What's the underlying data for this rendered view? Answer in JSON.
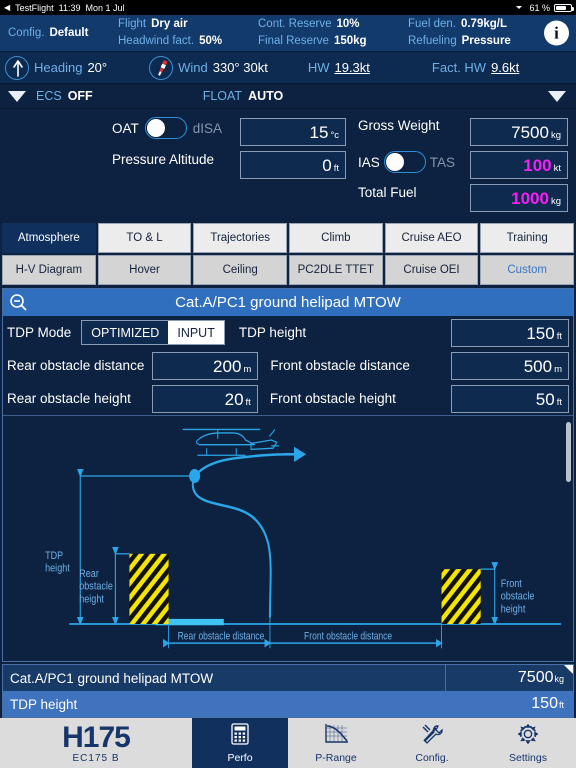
{
  "statusbar": {
    "back_label": "TestFlight",
    "time": "11:39",
    "date": "Mon 1 Jul",
    "battery_percent": "61 %"
  },
  "config_header": {
    "config_label": "Config.",
    "config_value": "Default",
    "flight_label": "Flight",
    "flight_value": "Dry air",
    "headwind_label": "Headwind fact.",
    "headwind_value": "50%",
    "cont_reserve_label": "Cont. Reserve",
    "cont_reserve_value": "10%",
    "final_reserve_label": "Final Reserve",
    "final_reserve_value": "150kg",
    "fuel_den_label": "Fuel den.",
    "fuel_den_value": "0.79kg/L",
    "refueling_label": "Refueling",
    "refueling_value": "Pressure",
    "info_label": "i"
  },
  "windbar": {
    "heading_label": "Heading",
    "heading_value": "20°",
    "wind_label": "Wind",
    "wind_value": "330° 30kt",
    "hw_label": "HW",
    "hw_value": "19.3kt",
    "fact_hw_label": "Fact. HW",
    "fact_hw_value": "9.6kt"
  },
  "ecsbar": {
    "ecs_label": "ECS",
    "ecs_value": "OFF",
    "float_label": "FLOAT",
    "float_value": "AUTO"
  },
  "inputs": {
    "oat_label": "OAT",
    "disa_label": "dISA",
    "oat_value": "15",
    "oat_unit": "°c",
    "pressure_alt_label": "Pressure Altitude",
    "pressure_alt_value": "0",
    "pressure_alt_unit": "ft",
    "gross_weight_label": "Gross Weight",
    "gross_weight_value": "7500",
    "gross_weight_unit": "kg",
    "ias_label": "IAS",
    "tas_label": "TAS",
    "ias_value": "100",
    "ias_unit": "kt",
    "total_fuel_label": "Total Fuel",
    "total_fuel_value": "1000",
    "total_fuel_unit": "kg"
  },
  "tabs": {
    "row1": [
      {
        "label": "Atmosphere",
        "state": "normal"
      },
      {
        "label": "TO & L",
        "state": "selected"
      },
      {
        "label": "Trajectories",
        "state": "normal"
      },
      {
        "label": "Climb",
        "state": "normal"
      },
      {
        "label": "Cruise AEO",
        "state": "normal"
      },
      {
        "label": "Training",
        "state": "normal"
      }
    ],
    "row2": [
      {
        "label": "H-V Diagram",
        "state": "alt"
      },
      {
        "label": "Hover",
        "state": "alt"
      },
      {
        "label": "Ceiling",
        "state": "alt"
      },
      {
        "label": "PC2DLE TTET",
        "state": "alt"
      },
      {
        "label": "Cruise OEI",
        "state": "alt"
      },
      {
        "label": "Custom",
        "state": "link"
      }
    ]
  },
  "panel": {
    "title": "Cat.A/PC1 ground helipad MTOW",
    "tdp_mode_label": "TDP Mode",
    "tdp_mode_optimized": "OPTIMIZED",
    "tdp_mode_input": "INPUT",
    "tdp_height_label": "TDP height",
    "tdp_height_value": "150",
    "tdp_height_unit": "ft",
    "rear_obstacle_distance_label": "Rear obstacle distance",
    "rear_obstacle_distance_value": "200",
    "rear_obstacle_distance_unit": "m",
    "front_obstacle_distance_label": "Front obstacle distance",
    "front_obstacle_distance_value": "500",
    "front_obstacle_distance_unit": "m",
    "rear_obstacle_height_label": "Rear obstacle height",
    "rear_obstacle_height_value": "20",
    "rear_obstacle_height_unit": "ft",
    "front_obstacle_height_label": "Front obstacle height",
    "front_obstacle_height_value": "50",
    "front_obstacle_height_unit": "ft"
  },
  "diagram": {
    "tdp_height_caption": "TDP\nheight",
    "tdp_height_line1": "TDP",
    "tdp_height_line2": "height",
    "rear_obstacle_height_line1": "Rear",
    "rear_obstacle_height_line2": "obstacle",
    "rear_obstacle_height_line3": "height",
    "front_obstacle_height_line1": "Front",
    "front_obstacle_height_line2": "obstacle",
    "front_obstacle_height_line3": "height",
    "rear_obstacle_distance_caption": "Rear obstacle distance",
    "front_obstacle_distance_caption": "Front obstacle distance"
  },
  "results": [
    {
      "label": "Cat.A/PC1 ground helipad MTOW",
      "value": "7500",
      "unit": "kg",
      "style": "dark"
    },
    {
      "label": "TDP height",
      "value": "150",
      "unit": "ft",
      "style": "light"
    }
  ],
  "bottombar": {
    "model": "H175",
    "model_sub": "EC175 B",
    "items": [
      {
        "label": "Perfo",
        "icon": "calculator-icon",
        "active": true
      },
      {
        "label": "P-Range",
        "icon": "chart-icon",
        "active": false
      },
      {
        "label": "Config.",
        "icon": "tools-icon",
        "active": false
      },
      {
        "label": "Settings",
        "icon": "gear-icon",
        "active": false
      }
    ]
  },
  "colors": {
    "accent_blue": "#2f6fbd",
    "label_blue": "#6fb0e8",
    "magenta": "#f51ff5",
    "hazard_yellow": "#f5e600",
    "diagram_cyan": "#2ba6e8"
  }
}
